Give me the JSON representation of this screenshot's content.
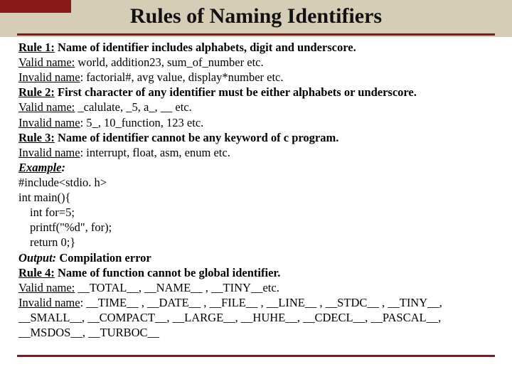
{
  "header": {
    "title": "Rules of Naming Identifiers"
  },
  "labels": {
    "rule1": "Rule 1:",
    "rule2": "Rule 2:",
    "rule3": "Rule 3:",
    "rule4": "Rule 4:",
    "validname": "Valid name:",
    "invalidname": "Invalid name",
    "example": "Example",
    "output": "Output:"
  },
  "rule1": {
    "text": " Name of identifier includes alphabets, digit   and underscore.",
    "valid": "world, addition23, sum_of_number etc.",
    "invalid": ": factorial#, avg value, display*number etc."
  },
  "rule2": {
    "text": " First character of any identifier must be either alphabets or underscore.",
    "valid": " _calulate, _5, a_, __ etc.",
    "invalid": ": 5_, 10_function, 123 etc."
  },
  "rule3": {
    "text": " Name of identifier cannot be any keyword of c program.",
    "invalid": ": interrupt, float, asm, enum etc."
  },
  "code": {
    "l1": "#include<stdio. h>",
    "l2": "int main(){",
    "l3": "int for=5;",
    "l4": "printf(\"%d\", for);",
    "l5": "return 0;}"
  },
  "output_text": " Compilation error",
  "rule4": {
    "text": " Name of function cannot be global identifier.",
    "valid": " __TOTAL__, __NAME__  , __TINY__etc.",
    "invalid": ": __TIME__ , __DATE__ , __FILE__ , __LINE__ , __STDC__ , __TINY__, __SMALL__, __COMPACT__, __LARGE__, __HUHE__, __CDECL__, __PASCAL__, __MSDOS__, __TURBOC__"
  }
}
